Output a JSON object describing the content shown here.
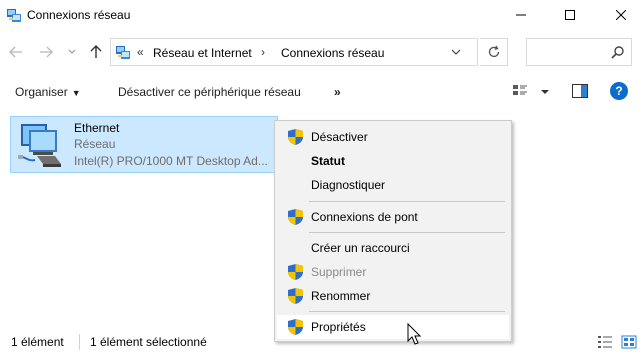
{
  "window": {
    "title": "Connexions réseau",
    "icon": "network-connections-icon",
    "controls": [
      "minimize-icon",
      "maximize-icon",
      "close-icon"
    ]
  },
  "addressbar": {
    "back_icon": "arrow-left-icon",
    "forward_icon": "arrow-right-icon",
    "recent_icon": "chevron-down-icon",
    "up_icon": "arrow-up-icon",
    "overflow": "«",
    "crumbs": [
      "Réseau et Internet",
      "Connexions réseau"
    ],
    "separator": "›",
    "refresh_icon": "refresh-icon",
    "search_placeholder": "",
    "search_icon": "search-icon"
  },
  "commandbar": {
    "organize_label": "Organiser",
    "disable_device_label": "Désactiver ce périphérique réseau",
    "more_label": "»",
    "help_label": "?",
    "icons": [
      "view-options-icon",
      "preview-pane-icon",
      "help-icon"
    ]
  },
  "item": {
    "name": "Ethernet",
    "status": "Réseau",
    "device": "Intel(R) PRO/1000 MT Desktop Ad...",
    "icon": "network-adapter-icon"
  },
  "context_menu": {
    "items": [
      {
        "label": "Désactiver",
        "shield": true,
        "bold": false,
        "disabled": false
      },
      {
        "label": "Statut",
        "shield": false,
        "bold": true,
        "disabled": false
      },
      {
        "label": "Diagnostiquer",
        "shield": false,
        "bold": false,
        "disabled": false
      },
      {
        "label": "Connexions de pont",
        "shield": true,
        "bold": false,
        "disabled": false
      },
      {
        "label": "Créer un raccourci",
        "shield": false,
        "bold": false,
        "disabled": false
      },
      {
        "label": "Supprimer",
        "shield": true,
        "bold": false,
        "disabled": true
      },
      {
        "label": "Renommer",
        "shield": true,
        "bold": false,
        "disabled": false
      },
      {
        "label": "Propriétés",
        "shield": true,
        "bold": false,
        "disabled": false,
        "hovered": true
      }
    ]
  },
  "statusbar": {
    "count": "1 élément",
    "selected": "1 élément sélectionné",
    "icons": [
      "details-view-icon",
      "tiles-view-icon"
    ]
  },
  "colors": {
    "selection_bg": "#cce8ff",
    "selection_border": "#99d1ff",
    "menu_bg": "#f2f2f2",
    "help_blue": "#0a6ccd"
  }
}
